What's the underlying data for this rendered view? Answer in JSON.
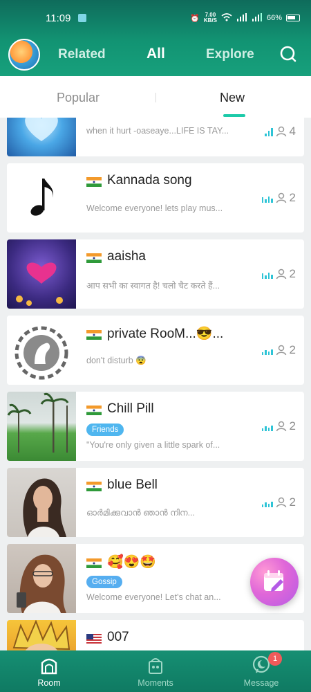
{
  "status_bar": {
    "time": "11:09",
    "net_speed": "7.00",
    "net_unit": "KB/S",
    "battery": "66%"
  },
  "header": {
    "nav": {
      "related": "Related",
      "all": "All",
      "explore": "Explore"
    },
    "icons": {
      "search": "search-icon"
    }
  },
  "tabs": {
    "popular": "Popular",
    "new": "New",
    "active": "New"
  },
  "rooms": [
    {
      "title": "",
      "desc": "when it hurt -oaseaye...LIFE IS TAY...",
      "count": "4",
      "flag": "india",
      "thumb": "blue-winged-heart"
    },
    {
      "title": "Kannada song",
      "desc": "Welcome everyone! lets play mus...",
      "count": "2",
      "flag": "india",
      "thumb": "music-note"
    },
    {
      "title": "aaisha",
      "desc": "आप सभी का स्वागत है! चलो चैट करते हैं...",
      "count": "2",
      "flag": "india",
      "thumb": "i-love-you"
    },
    {
      "title": "private RooM...😎...",
      "desc": "don't disturb 😨",
      "count": "2",
      "flag": "india",
      "thumb": "horse-emblem"
    },
    {
      "title": "Chill Pill",
      "tag": "Friends",
      "desc": "\"You're only given a little spark of...",
      "count": "2",
      "flag": "india",
      "thumb": "palm-field"
    },
    {
      "title": "blue Bell",
      "desc": "ഓർമിക്കുവാൻ ഞാൻ നിന...",
      "count": "2",
      "flag": "india",
      "thumb": "woman-portrait"
    },
    {
      "title": "🥰😍🤩",
      "tag": "Gossip",
      "desc": "Welcome everyone! Let's chat an...",
      "count": "",
      "flag": "india",
      "thumb": "woman-phone"
    },
    {
      "title": "007",
      "desc": "",
      "count": "",
      "flag": "usa",
      "thumb": "anime-character"
    }
  ],
  "bottom_nav": {
    "room": "Room",
    "moments": "Moments",
    "message": "Message",
    "message_badge": "1",
    "active": "Room"
  },
  "colors": {
    "header": "#129473",
    "accent": "#1ccaa9",
    "tag_blue": "#4fb6ef",
    "badge": "#f05a5a"
  }
}
